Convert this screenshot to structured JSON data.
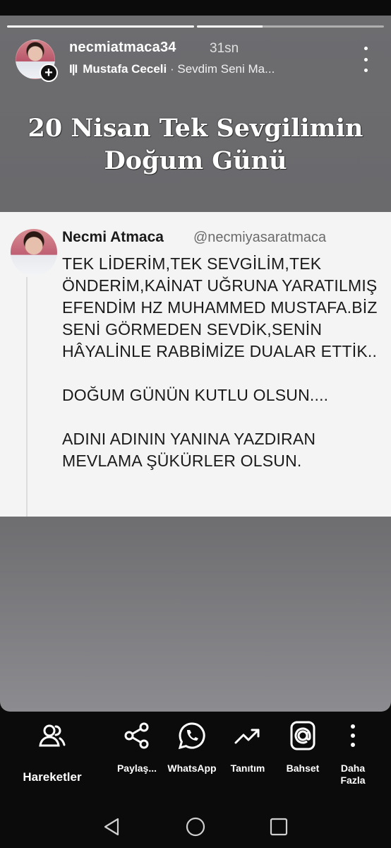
{
  "story": {
    "progress": [
      1.0,
      0.35
    ],
    "username": "necmiatmaca34",
    "time": "31sn",
    "music": {
      "bars": "I|I",
      "artist": "Mustafa Ceceli",
      "separator": " · ",
      "song": "Sevdim Seni Ma..."
    },
    "headline": "20 Nisan Tek Sevgilimin Doğum Günü"
  },
  "tweet": {
    "name": "Necmi Atmaca",
    "handle": "@necmiyasaratmaca",
    "paragraphs": [
      "TEK LİDERİM,TEK SEVGİLİM,TEK ÖNDERİM,KAİNAT UĞRUNA YARATILMIŞ EFENDİM HZ MUHAMMED MUSTAFA.BİZ SENİ GÖRMEDEN SEVDİK,SENİN HÂYALİNLE RABBİMİZE DUALAR ETTİK..",
      "DOĞUM GÜNÜN KUTLU OLSUN....",
      "ADINI ADININ YANINA YAZDIRAN MEVLAMA ŞÜKÜRLER OLSUN."
    ]
  },
  "actions": [
    {
      "label": "Hareketler",
      "icon": "people-icon"
    },
    {
      "label": "Paylaş...",
      "icon": "share-icon"
    },
    {
      "label": "WhatsApp",
      "icon": "whatsapp-icon"
    },
    {
      "label": "Tanıtım",
      "icon": "trending-icon"
    },
    {
      "label": "Bahset",
      "icon": "mention-icon"
    },
    {
      "label": "Daha Fazla",
      "icon": "more-vertical-icon"
    }
  ],
  "nav": [
    "back-icon",
    "home-icon",
    "recents-icon"
  ]
}
